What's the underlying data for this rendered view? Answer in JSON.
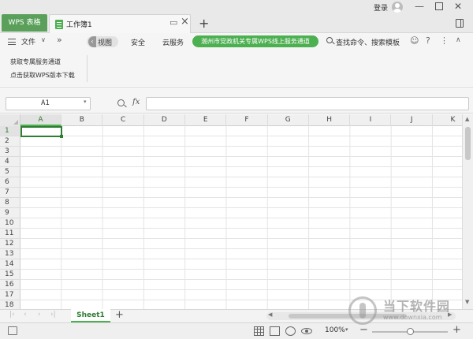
{
  "titlebar": {
    "app_tab": "WPS 表格",
    "doc_tab": "工作簿1",
    "login": "登录",
    "add_tab": "+",
    "win_min": "—",
    "win_close": "✕"
  },
  "ribbon": {
    "file": "文件",
    "view": "视图",
    "security": "安全",
    "cloud": "云服务",
    "promo": "潮州市党政机关专属WPS线上服务通道",
    "search": "查找命令、搜索模板",
    "sub1": "获取专属服务通道",
    "sub2": "点击获取WPS版本下载"
  },
  "formula": {
    "namebox": "A1",
    "fx": "fx",
    "value": ""
  },
  "grid": {
    "columns": [
      "A",
      "B",
      "C",
      "D",
      "E",
      "F",
      "G",
      "H",
      "I",
      "J",
      "K"
    ],
    "rows": [
      "1",
      "2",
      "3",
      "4",
      "5",
      "6",
      "7",
      "8",
      "9",
      "10",
      "11",
      "12",
      "13",
      "14",
      "15",
      "16",
      "17",
      "18"
    ],
    "active_cell": "A1"
  },
  "sheets": {
    "active": "Sheet1",
    "add": "+"
  },
  "status": {
    "zoom": "100%",
    "zoom_level": 1.0
  },
  "watermark": {
    "name": "当下软件园",
    "url": "www.downxia.com"
  },
  "colors": {
    "accent": "#4caf50",
    "accent_dark": "#2e7d32"
  }
}
